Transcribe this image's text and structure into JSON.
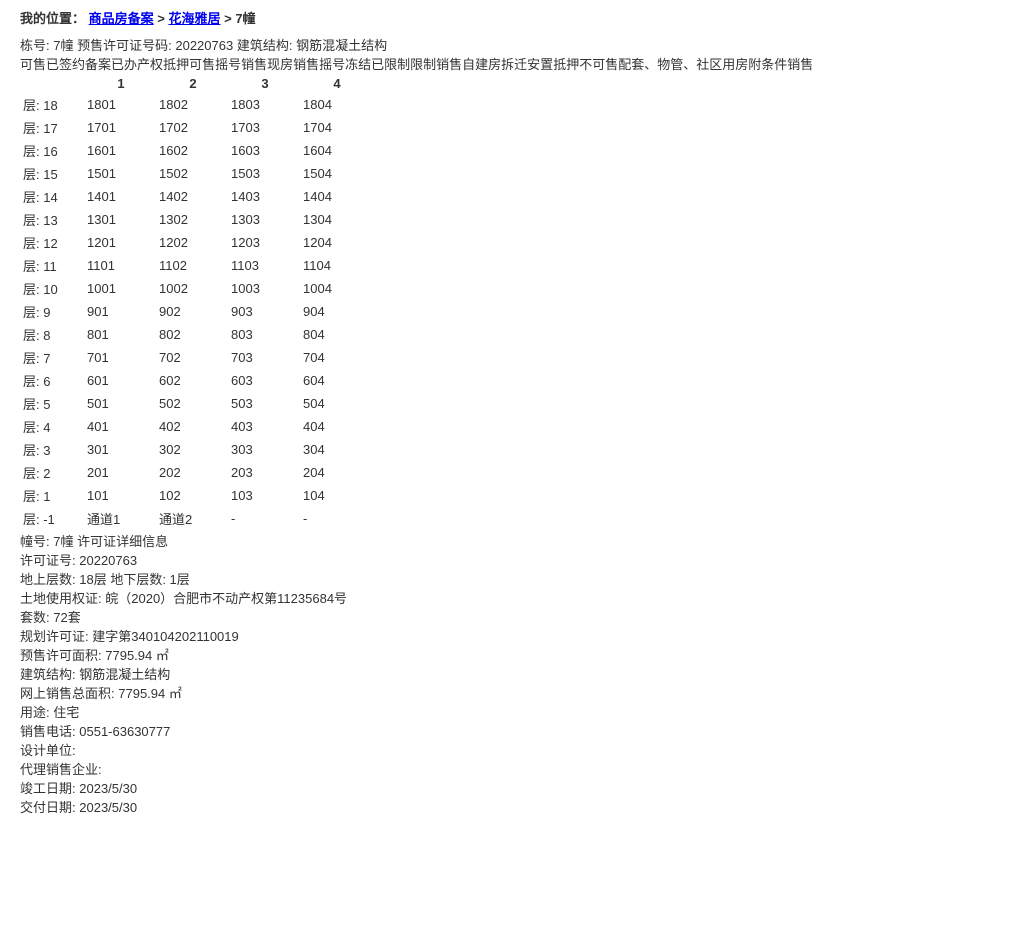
{
  "breadcrumb": {
    "prefix": "我的位置：",
    "items": [
      "商品房备案",
      "花海雅居",
      "7幢"
    ]
  },
  "header": {
    "building_lbl": "栋号:",
    "building": "7幢",
    "permit_lbl": "预售许可证号码:",
    "permit": "20220763",
    "struct_lbl": "建筑结构:",
    "struct": "钢筋混凝土结构"
  },
  "legend": [
    {
      "c": "#00bf00",
      "t": "可售"
    },
    {
      "c": "#0029ff",
      "t": "已签约"
    },
    {
      "c": "#e80000",
      "t": "备案"
    },
    {
      "c": "#0a4b0a",
      "t": "已办产权"
    },
    {
      "c": "#fcb4e0",
      "t": "抵押可售"
    },
    {
      "c": "#efa23f",
      "t": "摇号销售"
    },
    {
      "c": "#56a3ff",
      "t": "现房销售"
    },
    {
      "c": "#bbe67e",
      "t": "摇号冻结"
    },
    {
      "c": "#a3a3a3",
      "t": "已限制"
    },
    {
      "c": "#c16a1f",
      "t": "限制销售"
    },
    {
      "c": "#2d9f5a",
      "t": "自建房"
    },
    {
      "c": "#38e0e0",
      "t": "拆迁安置"
    },
    {
      "c": "#c21d8a",
      "t": "抵押不可售"
    },
    {
      "c": "#193b66",
      "t": "配套、物管、社区用房",
      "wide": true
    },
    {
      "c": "#e79d3a",
      "t": "附条件销售"
    }
  ],
  "table_head": [
    "1",
    "2",
    "3",
    "4"
  ],
  "floor_lbl": "层:",
  "floors": [
    {
      "f": "18",
      "u": [
        "1801",
        "1802",
        "1803",
        "1804"
      ],
      "cls": "pink"
    },
    {
      "f": "17",
      "u": [
        "1701",
        "1702",
        "1703",
        "1704"
      ],
      "cls": "pink"
    },
    {
      "f": "16",
      "u": [
        "1601",
        "1602",
        "1603",
        "1604"
      ],
      "cls": "pink"
    },
    {
      "f": "15",
      "u": [
        "1501",
        "1502",
        "1503",
        "1504"
      ],
      "cls": "pink"
    },
    {
      "f": "14",
      "u": [
        "1401",
        "1402",
        "1403",
        "1404"
      ],
      "cls": "pink"
    },
    {
      "f": "13",
      "u": [
        "1301",
        "1302",
        "1303",
        "1304"
      ],
      "cls": "pink"
    },
    {
      "f": "12",
      "u": [
        "1201",
        "1202",
        "1203",
        "1204"
      ],
      "cls": "pink"
    },
    {
      "f": "11",
      "u": [
        "1101",
        "1102",
        "1103",
        "1104"
      ],
      "cls": "pink"
    },
    {
      "f": "10",
      "u": [
        "1001",
        "1002",
        "1003",
        "1004"
      ],
      "cls": "pink"
    },
    {
      "f": "9",
      "u": [
        "901",
        "902",
        "903",
        "904"
      ],
      "cls": "pink"
    },
    {
      "f": "8",
      "u": [
        "801",
        "802",
        "803",
        "804"
      ],
      "cls": "pink"
    },
    {
      "f": "7",
      "u": [
        "701",
        "702",
        "703",
        "704"
      ],
      "cls": "pink"
    },
    {
      "f": "6",
      "u": [
        "601",
        "602",
        "603",
        "604"
      ],
      "cls": "pink"
    },
    {
      "f": "5",
      "u": [
        "501",
        "502",
        "503",
        "504"
      ],
      "cls": "pink"
    },
    {
      "f": "4",
      "u": [
        "401",
        "402",
        "403",
        "404"
      ],
      "cls": "pink"
    },
    {
      "f": "3",
      "u": [
        "301",
        "302",
        "303",
        "304"
      ],
      "cls": "pink"
    },
    {
      "f": "2",
      "u": [
        "201",
        "202",
        "203",
        "204"
      ],
      "cls": "pink"
    },
    {
      "f": "1",
      "u": [
        "101",
        "102",
        "103",
        "104"
      ],
      "cls": "pink"
    },
    {
      "f": "-1",
      "u": [
        "通道1",
        "通道2",
        "-",
        "-"
      ],
      "cls": "mix"
    }
  ],
  "detail_title": "幢号: 7幢 许可证详细信息",
  "details": [
    {
      "l": "许可证号:",
      "v": "20220763"
    },
    {
      "l": "地上层数:",
      "v": "18层  地下层数: 1层"
    },
    {
      "l": "土地使用权证:",
      "v": "皖（2020）合肥市不动产权第11235684号"
    },
    {
      "l": "套数:",
      "v": "72套"
    },
    {
      "l": "规划许可证:",
      "v": "建字第340104202110019"
    },
    {
      "l": "预售许可面积:",
      "v": "7795.94 ㎡"
    },
    {
      "l": "建筑结构:",
      "v": "钢筋混凝土结构"
    },
    {
      "l": "网上销售总面积:",
      "v": "7795.94 ㎡"
    },
    {
      "l": "用途:",
      "v": "住宅"
    },
    {
      "l": "销售电话:",
      "v": "0551-63630777"
    },
    {
      "l": "设计单位:",
      "v": ""
    },
    {
      "l": "代理销售企业:",
      "v": ""
    },
    {
      "l": "竣工日期:",
      "v": "2023/5/30"
    },
    {
      "l": "交付日期:",
      "v": "2023/5/30"
    }
  ]
}
